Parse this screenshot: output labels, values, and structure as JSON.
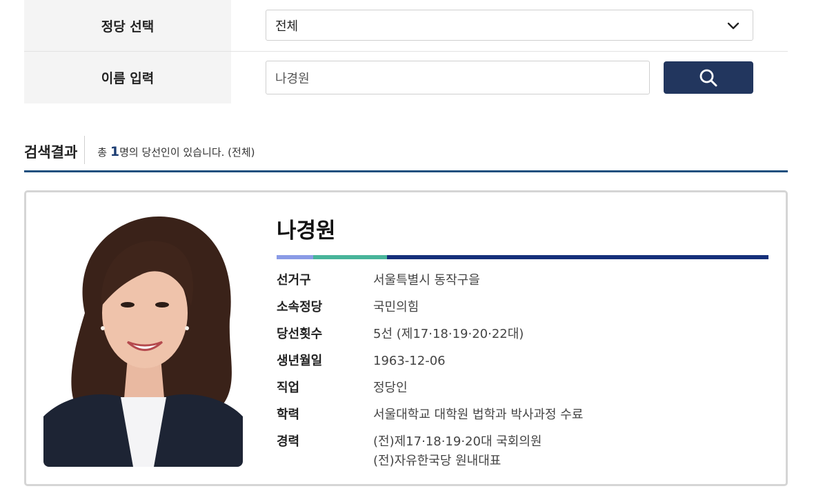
{
  "filters": {
    "party_label": "정당 선택",
    "party_value": "전체",
    "name_label": "이름 입력",
    "name_value": "나경원"
  },
  "results": {
    "title": "검색결과",
    "summary_prefix": "총 ",
    "count": "1",
    "summary_suffix": "명의 당선인이 있습니다. (전체)"
  },
  "person": {
    "name": "나경원",
    "details": [
      {
        "key": "선거구",
        "value": "서울특별시 동작구을"
      },
      {
        "key": "소속정당",
        "value": "국민의힘"
      },
      {
        "key": "당선횟수",
        "value": "5선 (제17·18·19·20·22대)"
      },
      {
        "key": "생년월일",
        "value": "1963-12-06"
      },
      {
        "key": "직업",
        "value": "정당인"
      },
      {
        "key": "학력",
        "value": "서울대학교 대학원 법학과 박사과정 수료"
      },
      {
        "key": "경력",
        "value": "(전)제17·18·19·20대 국회의원",
        "value2": "(전)자유한국당 원내대표"
      }
    ]
  },
  "colors": {
    "search_button": "#22365e",
    "result_rule": "#1b4f7e",
    "bar_light": "#8a9be6",
    "bar_green": "#48b49a",
    "bar_navy": "#15307a"
  },
  "icons": {
    "dropdown": "chevron-down-icon",
    "search": "search-icon"
  }
}
